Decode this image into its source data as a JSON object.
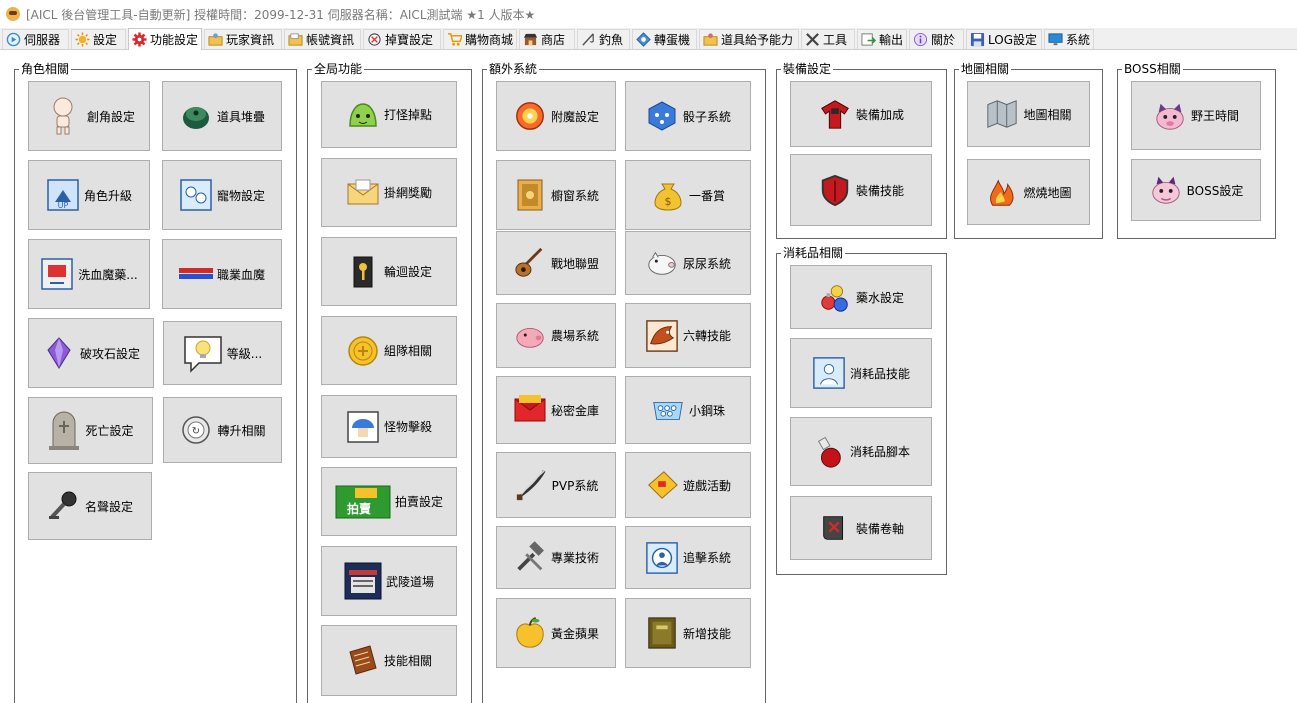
{
  "window": {
    "title": "[AICL 後台管理工具-自動更新] 授權時間：2099-12-31  伺服器名稱：AICL測試端  ★1 人版本★"
  },
  "tabs": [
    {
      "label": "伺服器",
      "icon": "server-icon",
      "active": false
    },
    {
      "label": "設定",
      "icon": "sun-gear-icon",
      "active": false
    },
    {
      "label": "功能設定",
      "icon": "gear-icon",
      "active": true
    },
    {
      "label": "玩家資訊",
      "icon": "user-folder-icon",
      "active": false
    },
    {
      "label": "帳號資訊",
      "icon": "account-icon",
      "active": false
    },
    {
      "label": "掉寶設定",
      "icon": "treasure-icon",
      "active": false
    },
    {
      "label": "購物商城",
      "icon": "cart-icon",
      "active": false
    },
    {
      "label": "商店",
      "icon": "shop-icon",
      "active": false
    },
    {
      "label": "釣魚",
      "icon": "fishing-icon",
      "active": false
    },
    {
      "label": "轉蛋機",
      "icon": "gacha-icon",
      "active": false
    },
    {
      "label": "道具給予能力",
      "icon": "item-folder-icon",
      "active": false
    },
    {
      "label": "工具",
      "icon": "tools-icon",
      "active": false
    },
    {
      "label": "輸出",
      "icon": "export-icon",
      "active": false
    },
    {
      "label": "關於",
      "icon": "info-icon",
      "active": false
    },
    {
      "label": "LOG設定",
      "icon": "save-icon",
      "active": false
    },
    {
      "label": "系統",
      "icon": "monitor-icon",
      "active": false
    }
  ],
  "groups": {
    "role": {
      "title": "角色相關",
      "buttons": [
        {
          "label": "創角設定",
          "icon": "character-icon"
        },
        {
          "label": "道具堆疊",
          "icon": "stack-icon"
        },
        {
          "label": "角色升級",
          "icon": "levelup-icon"
        },
        {
          "label": "寵物設定",
          "icon": "pet-icon"
        },
        {
          "label": "洗血魔藥...",
          "icon": "potion-card-icon"
        },
        {
          "label": "職業血魔",
          "icon": "hp-mp-bar-icon"
        },
        {
          "label": "破攻石設定",
          "icon": "crystal-icon"
        },
        {
          "label": "等級...",
          "icon": "lightbulb-icon"
        },
        {
          "label": "死亡設定",
          "icon": "tombstone-icon"
        },
        {
          "label": "轉升相關",
          "icon": "coin-icon"
        },
        {
          "label": "名聲設定",
          "icon": "microphone-icon"
        }
      ]
    },
    "global": {
      "title": "全局功能",
      "buttons": [
        {
          "label": "打怪掉點",
          "icon": "slime-icon"
        },
        {
          "label": "掛網獎勵",
          "icon": "envelope-icon"
        },
        {
          "label": "輪迴設定",
          "icon": "key-icon"
        },
        {
          "label": "組隊相關",
          "icon": "gold-coin-icon"
        },
        {
          "label": "怪物擊殺",
          "icon": "mushroom-icon"
        },
        {
          "label": "拍賣設定",
          "icon": "auction-icon",
          "icon_text": "拍賣"
        },
        {
          "label": "武陵道場",
          "icon": "dojo-icon"
        },
        {
          "label": "技能相關",
          "icon": "skill-book-icon"
        }
      ]
    },
    "extra": {
      "title": "額外系統",
      "buttons": [
        {
          "label": "附魔設定",
          "icon": "enchant-orb-icon"
        },
        {
          "label": "骰子系統",
          "icon": "dice-icon"
        },
        {
          "label": "櫥窗系統",
          "icon": "showcase-icon"
        },
        {
          "label": "一番賞",
          "icon": "money-bag-icon"
        },
        {
          "label": "戰地聯盟",
          "icon": "guitar-icon"
        },
        {
          "label": "尿尿系統",
          "icon": "pig-icon"
        },
        {
          "label": "農場系統",
          "icon": "farm-pig-icon"
        },
        {
          "label": "六轉技能",
          "icon": "dragon-icon"
        },
        {
          "label": "秘密金庫",
          "icon": "red-envelope-icon"
        },
        {
          "label": "小鋼珠",
          "icon": "pachinko-icon"
        },
        {
          "label": "PVP系統",
          "icon": "sword-icon"
        },
        {
          "label": "遊戲活動",
          "icon": "ticket-icon"
        },
        {
          "label": "專業技術",
          "icon": "hammer-icon"
        },
        {
          "label": "追擊系統",
          "icon": "pursuit-icon"
        },
        {
          "label": "黃金蘋果",
          "icon": "golden-apple-icon"
        },
        {
          "label": "新增技能",
          "icon": "book-icon"
        }
      ]
    },
    "equip": {
      "title": "裝備設定",
      "buttons": [
        {
          "label": "裝備加成",
          "icon": "armor-icon"
        },
        {
          "label": "裝備技能",
          "icon": "shield-icon"
        }
      ]
    },
    "map": {
      "title": "地圖相關",
      "buttons": [
        {
          "label": "地圖相關",
          "icon": "map-icon"
        },
        {
          "label": "燃燒地圖",
          "icon": "fire-icon"
        }
      ]
    },
    "boss": {
      "title": "BOSS相關",
      "buttons": [
        {
          "label": "野王時間",
          "icon": "boss-pig-icon"
        },
        {
          "label": "BOSS設定",
          "icon": "boss-icon"
        }
      ]
    },
    "consumable": {
      "title": "消耗品相關",
      "buttons": [
        {
          "label": "藥水設定",
          "icon": "potions-icon"
        },
        {
          "label": "消耗品技能",
          "icon": "consumable-skill-icon"
        },
        {
          "label": "消耗品腳本",
          "icon": "flask-icon"
        },
        {
          "label": "裝備卷軸",
          "icon": "scroll-icon"
        }
      ]
    }
  }
}
